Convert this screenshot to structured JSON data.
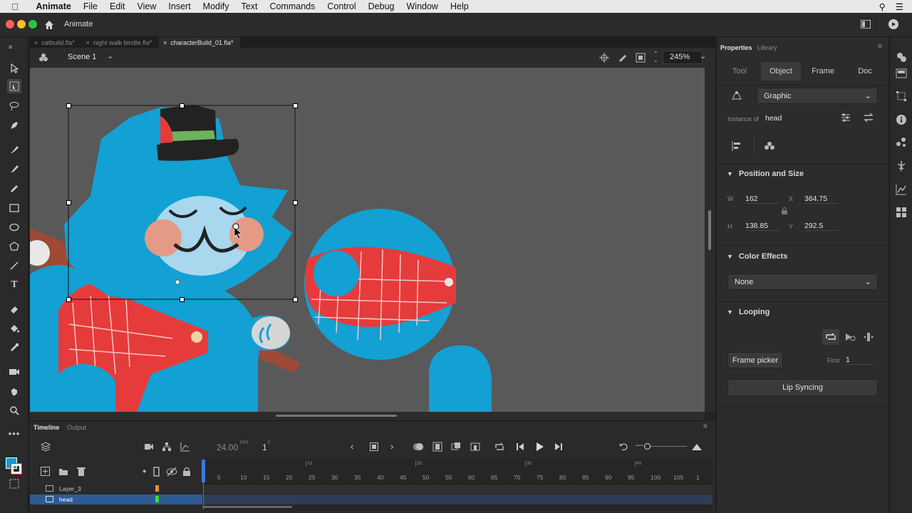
{
  "menubar": {
    "app_name": "Animate",
    "items": [
      "File",
      "Edit",
      "View",
      "Insert",
      "Modify",
      "Text",
      "Commands",
      "Control",
      "Debug",
      "Window",
      "Help"
    ]
  },
  "titlebar": {
    "home_title": "Animate"
  },
  "doc_tabs": [
    {
      "label": "catbuild.fla*",
      "active": false
    },
    {
      "label": "night walk bindle.fla*",
      "active": false
    },
    {
      "label": "characterBuild_01.fla*",
      "active": true
    }
  ],
  "scene": {
    "label": "Scene 1",
    "zoom": "245%"
  },
  "properties": {
    "header_tabs": [
      "Properties",
      "Library"
    ],
    "mode_tabs": [
      "Tool",
      "Object",
      "Frame",
      "Doc"
    ],
    "active_mode": "Object",
    "symbol_type": "Graphic",
    "instance_label": "Instance of",
    "instance_name": "head",
    "position_size": {
      "title": "Position and Size",
      "w_label": "W",
      "w": "162",
      "h_label": "H",
      "h": "138.85",
      "x_label": "X",
      "x": "364.75",
      "y_label": "Y",
      "y": "292.5"
    },
    "color_effects": {
      "title": "Color Effects",
      "value": "None"
    },
    "looping": {
      "title": "Looping",
      "frame_picker": "Frame picker",
      "first_label": "First",
      "first_value": "1",
      "lip_syncing": "Lip Syncing"
    }
  },
  "timeline": {
    "tabs": [
      "Timeline",
      "Output"
    ],
    "fps": "24.00",
    "fps_unit": "FPS",
    "frame": "1",
    "frame_unit": "F",
    "layers": [
      {
        "name": "Layer_3",
        "color": "#f08c28",
        "selected": false
      },
      {
        "name": "head",
        "color": "#3cdc3c",
        "selected": true
      }
    ],
    "ruler_numbers": [
      "5",
      "10",
      "15",
      "20",
      "25",
      "30",
      "35",
      "40",
      "45",
      "50",
      "55",
      "60",
      "65",
      "70",
      "75",
      "80",
      "85",
      "90",
      "95",
      "100",
      "105",
      "1"
    ],
    "second_marks": [
      "1s",
      "2s",
      "3s",
      "4s"
    ]
  },
  "colors": {
    "accent": "#1a9ad6",
    "selection_blue": "#2f5b95",
    "cat_blue": "#13a0d3",
    "vest_red": "#e63c3c"
  }
}
